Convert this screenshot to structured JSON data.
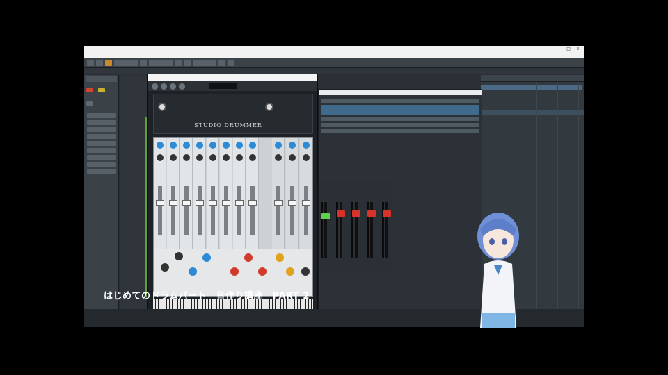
{
  "window": {
    "title": ""
  },
  "plugin": {
    "logo_text": "STUDIO DRUMMER"
  },
  "caption": "はじめてのドラムパート　音作り講座　PART 2",
  "colors": {
    "accent_orange": "#c88a2b",
    "knob_blue": "#2d8ad6",
    "knob_red": "#d03b2b",
    "knob_yellow": "#e0a21b",
    "fader_green": "#5ed04a",
    "fader_red": "#d8332b",
    "track_green": "#5ea33a"
  }
}
